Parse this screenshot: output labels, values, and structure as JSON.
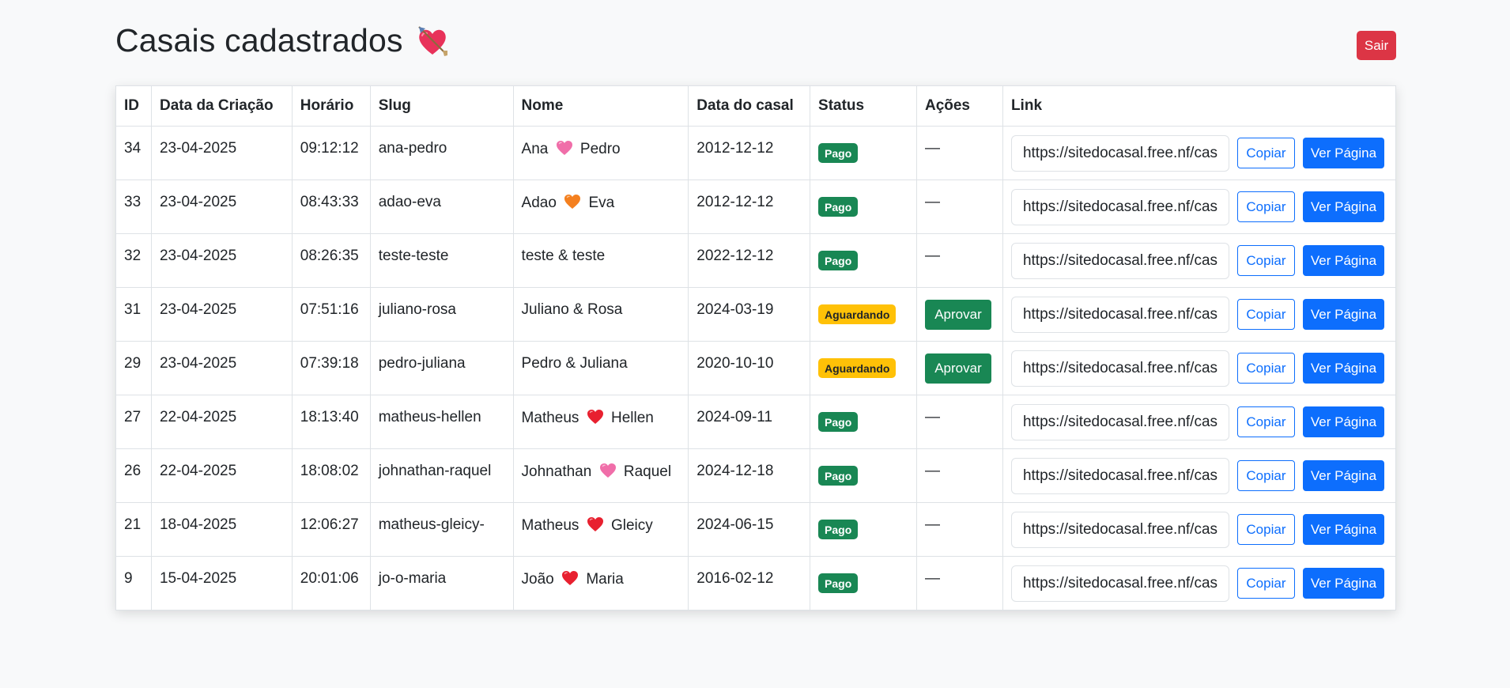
{
  "header": {
    "title": "Casais cadastrados",
    "title_emoji": "heart-with-arrow-icon",
    "logout_label": "Sair"
  },
  "table": {
    "columns": [
      "ID",
      "Data da Criação",
      "Horário",
      "Slug",
      "Nome",
      "Data do casal",
      "Status",
      "Ações",
      "Link"
    ],
    "rows": [
      {
        "id": "34",
        "created": "23-04-2025",
        "time": "09:12:12",
        "slug": "ana-pedro",
        "name_left": "Ana",
        "name_right": "Pedro",
        "heart": "pink-heart-icon",
        "heart_color": "#f06ea9",
        "couple_date": "2012-12-12",
        "status": "Pago",
        "status_type": "success",
        "action": "—",
        "link": "https://sitedocasal.free.nf/casal/ana-pedro",
        "copy_label": "Copiar",
        "view_label": "Ver Página"
      },
      {
        "id": "33",
        "created": "23-04-2025",
        "time": "08:43:33",
        "slug": "adao-eva",
        "name_left": "Adao",
        "name_right": "Eva",
        "heart": "orange-heart-icon",
        "heart_color": "#f4801f",
        "couple_date": "2012-12-12",
        "status": "Pago",
        "status_type": "success",
        "action": "—",
        "link": "https://sitedocasal.free.nf/casal/adao-eva",
        "copy_label": "Copiar",
        "view_label": "Ver Página"
      },
      {
        "id": "32",
        "created": "23-04-2025",
        "time": "08:26:35",
        "slug": "teste-teste",
        "name_left": "teste",
        "name_right": "teste",
        "heart": "",
        "heart_color": "",
        "couple_date": "2022-12-12",
        "status": "Pago",
        "status_type": "success",
        "action": "—",
        "link": "https://sitedocasal.free.nf/casal/teste-teste",
        "copy_label": "Copiar",
        "view_label": "Ver Página"
      },
      {
        "id": "31",
        "created": "23-04-2025",
        "time": "07:51:16",
        "slug": "juliano-rosa",
        "name_left": "Juliano",
        "name_right": "Rosa",
        "heart": "",
        "heart_color": "",
        "couple_date": "2024-03-19",
        "status": "Aguardando",
        "status_type": "warning",
        "action": "Aprovar",
        "link": "https://sitedocasal.free.nf/casal/juliano-rosa",
        "copy_label": "Copiar",
        "view_label": "Ver Página"
      },
      {
        "id": "29",
        "created": "23-04-2025",
        "time": "07:39:18",
        "slug": "pedro-juliana",
        "name_left": "Pedro",
        "name_right": "Juliana",
        "heart": "",
        "heart_color": "",
        "couple_date": "2020-10-10",
        "status": "Aguardando",
        "status_type": "warning",
        "action": "Aprovar",
        "link": "https://sitedocasal.free.nf/casal/pedro-juliana",
        "copy_label": "Copiar",
        "view_label": "Ver Página"
      },
      {
        "id": "27",
        "created": "22-04-2025",
        "time": "18:13:40",
        "slug": "matheus-hellen",
        "name_left": "Matheus",
        "name_right": "Hellen",
        "heart": "red-heart-icon",
        "heart_color": "#e8202f",
        "couple_date": "2024-09-11",
        "status": "Pago",
        "status_type": "success",
        "action": "—",
        "link": "https://sitedocasal.free.nf/casal/matheus-hellen",
        "copy_label": "Copiar",
        "view_label": "Ver Página"
      },
      {
        "id": "26",
        "created": "22-04-2025",
        "time": "18:08:02",
        "slug": "johnathan-raquel",
        "name_left": "Johnathan",
        "name_right": "Raquel",
        "heart": "pink-heart-icon",
        "heart_color": "#f06ea9",
        "couple_date": "2024-12-18",
        "status": "Pago",
        "status_type": "success",
        "action": "—",
        "link": "https://sitedocasal.free.nf/casal/johnathan-raquel",
        "copy_label": "Copiar",
        "view_label": "Ver Página"
      },
      {
        "id": "21",
        "created": "18-04-2025",
        "time": "12:06:27",
        "slug": "matheus-gleicy-",
        "name_left": "Matheus",
        "name_right": "Gleicy",
        "heart": "red-heart-icon",
        "heart_color": "#e8202f",
        "couple_date": "2024-06-15",
        "status": "Pago",
        "status_type": "success",
        "action": "—",
        "link": "https://sitedocasal.free.nf/casal/matheus-gleicy-",
        "copy_label": "Copiar",
        "view_label": "Ver Página"
      },
      {
        "id": "9",
        "created": "15-04-2025",
        "time": "20:01:06",
        "slug": "jo-o-maria",
        "name_left": "João",
        "name_right": "Maria",
        "heart": "red-heart-icon",
        "heart_color": "#e8202f",
        "couple_date": "2016-02-12",
        "status": "Pago",
        "status_type": "success",
        "action": "—",
        "link": "https://sitedocasal.free.nf/casal/jo-o-maria",
        "copy_label": "Copiar",
        "view_label": "Ver Página"
      }
    ]
  }
}
